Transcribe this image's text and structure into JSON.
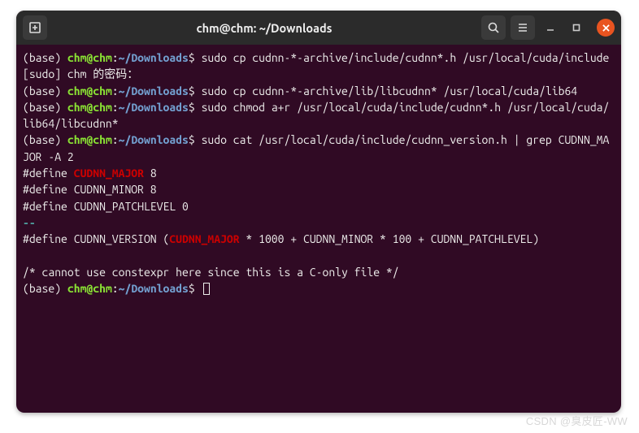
{
  "titlebar": {
    "title": "chm@chm: ~/Downloads"
  },
  "prompt": {
    "env": "(base) ",
    "user": "chm",
    "at": "@",
    "host": "chm",
    "colon": ":",
    "path": "~/Downloads",
    "dollar": "$ "
  },
  "lines": {
    "cmd1": "sudo cp cudnn-*-archive/include/cudnn*.h /usr/local/cuda/include",
    "sudo_pass": "[sudo] chm 的密码：",
    "cmd2": "sudo cp cudnn-*-archive/lib/libcudnn* /usr/local/cuda/lib64",
    "cmd3": "sudo chmod a+r /usr/local/cuda/include/cudnn*.h /usr/local/cuda/lib64/libcudnn*",
    "cmd4": "sudo cat /usr/local/cuda/include/cudnn_version.h | grep CUDNN_MAJOR -A 2",
    "def_pre": "#define ",
    "major_key": "CUDNN_MAJOR",
    "major_val": " 8",
    "minor": "#define CUDNN_MINOR 8",
    "patch": "#define CUDNN_PATCHLEVEL 0",
    "dashes": "--",
    "ver_pre": "#define CUDNN_VERSION (",
    "ver_post": " * 1000 + CUDNN_MINOR * 100 + CUDNN_PATCHLEVEL)",
    "blank": "",
    "comment": "/* cannot use constexpr here since this is a C-only file */"
  },
  "watermark": "CSDN @臭皮匠-WW"
}
